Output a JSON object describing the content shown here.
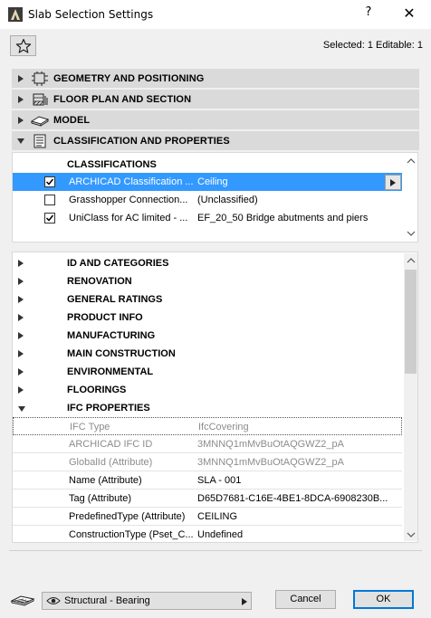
{
  "window": {
    "title": "Slab Selection Settings",
    "help_glyph": "?",
    "close_glyph": "✕"
  },
  "header": {
    "selected_info": "Selected: 1 Editable: 1"
  },
  "panels": [
    {
      "label": "GEOMETRY AND POSITIONING",
      "icon": "geometry-icon",
      "expanded": false
    },
    {
      "label": "FLOOR PLAN AND SECTION",
      "icon": "floor-plan-icon",
      "expanded": false
    },
    {
      "label": "MODEL",
      "icon": "model-icon",
      "expanded": false
    },
    {
      "label": "CLASSIFICATION AND PROPERTIES",
      "icon": "classification-icon",
      "expanded": true
    }
  ],
  "classifications": {
    "header": "CLASSIFICATIONS",
    "rows": [
      {
        "name": "ARCHICAD Classification ...",
        "value": "Ceiling",
        "checked": true,
        "selected": true
      },
      {
        "name": "Grasshopper Connection...",
        "value": "(Unclassified)",
        "checked": false,
        "selected": false
      },
      {
        "name": "UniClass for AC limited - ...",
        "value": "EF_20_50 Bridge abutments and piers",
        "checked": true,
        "selected": false
      }
    ]
  },
  "property_groups": [
    {
      "label": "ID AND CATEGORIES",
      "expanded": false
    },
    {
      "label": "RENOVATION",
      "expanded": false
    },
    {
      "label": "GENERAL RATINGS",
      "expanded": false
    },
    {
      "label": "PRODUCT INFO",
      "expanded": false
    },
    {
      "label": "MANUFACTURING",
      "expanded": false
    },
    {
      "label": "MAIN CONSTRUCTION",
      "expanded": false
    },
    {
      "label": "ENVIRONMENTAL",
      "expanded": false
    },
    {
      "label": "FLOORINGS",
      "expanded": false
    },
    {
      "label": "IFC PROPERTIES",
      "expanded": true
    }
  ],
  "ifc_properties": [
    {
      "name": "IFC Type",
      "value": "IfcCovering",
      "dim": true
    },
    {
      "name": "ARCHICAD IFC ID",
      "value": "3MNNQ1mMvBuOtAQGWZ2_pA",
      "dim": true
    },
    {
      "name": "GlobalId (Attribute)",
      "value": "3MNNQ1mMvBuOtAQGWZ2_pA",
      "dim": true
    },
    {
      "name": "Name (Attribute)",
      "value": "SLA - 001",
      "dim": false
    },
    {
      "name": "Tag (Attribute)",
      "value": "D65D7681-C16E-4BE1-8DCA-6908230B...",
      "dim": false
    },
    {
      "name": "PredefinedType (Attribute)",
      "value": "CEILING",
      "dim": false
    },
    {
      "name": "ConstructionType (Pset_C...",
      "value": "Undefined",
      "dim": false
    }
  ],
  "footer": {
    "layer_value": "Structural - Bearing",
    "cancel_label": "Cancel",
    "ok_label": "OK"
  },
  "colors": {
    "selection": "#3399ff",
    "panel_header": "#dadada",
    "ok_border": "#0078d7"
  }
}
